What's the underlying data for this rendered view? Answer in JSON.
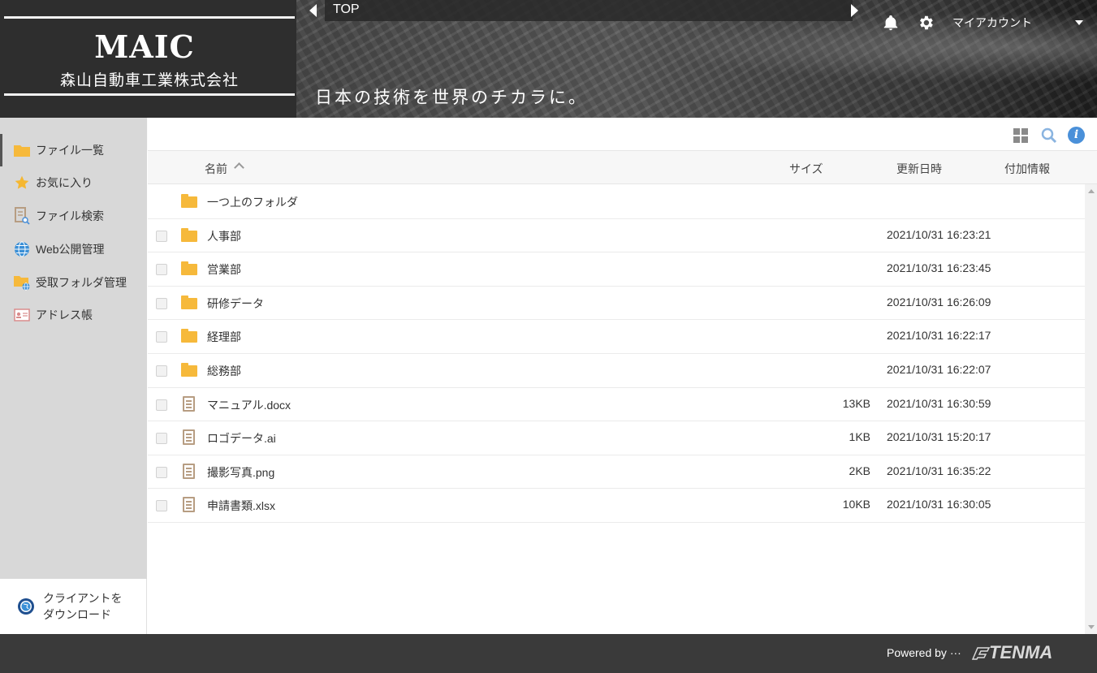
{
  "header": {
    "logo_title": "MAIC",
    "logo_subtitle": "森山自動車工業株式会社",
    "breadcrumb": "TOP",
    "account_label": "マイアカウント",
    "slogan": "日本の技術を世界のチカラに。",
    "icons": [
      "bell-icon",
      "gear-icon"
    ]
  },
  "sidebar": {
    "items": [
      {
        "label": "ファイル一覧",
        "icon": "folder-icon",
        "active": true
      },
      {
        "label": "お気に入り",
        "icon": "star-icon"
      },
      {
        "label": "ファイル検索",
        "icon": "file-search-icon"
      },
      {
        "label": "Web公開管理",
        "icon": "globe-icon"
      },
      {
        "label": "受取フォルダ管理",
        "icon": "folder-globe-icon"
      },
      {
        "label": "アドレス帳",
        "icon": "address-card-icon"
      }
    ],
    "client_download": "クライアントを\nダウンロード"
  },
  "table": {
    "headers": {
      "name": "名前",
      "size": "サイズ",
      "date": "更新日時",
      "extra": "付加情報"
    },
    "parent_folder": "一つ上のフォルダ",
    "rows": [
      {
        "type": "folder",
        "name": "人事部",
        "size": "",
        "date": "2021/10/31 16:23:21"
      },
      {
        "type": "folder",
        "name": "営業部",
        "size": "",
        "date": "2021/10/31 16:23:45"
      },
      {
        "type": "folder",
        "name": "研修データ",
        "size": "",
        "date": "2021/10/31 16:26:09"
      },
      {
        "type": "folder",
        "name": "経理部",
        "size": "",
        "date": "2021/10/31 16:22:17"
      },
      {
        "type": "folder",
        "name": "総務部",
        "size": "",
        "date": "2021/10/31 16:22:07"
      },
      {
        "type": "file",
        "name": "マニュアル.docx",
        "size": "13KB",
        "date": "2021/10/31 16:30:59"
      },
      {
        "type": "file",
        "name": "ロゴデータ.ai",
        "size": "1KB",
        "date": "2021/10/31 15:20:17"
      },
      {
        "type": "file",
        "name": "撮影写真.png",
        "size": "2KB",
        "date": "2021/10/31 16:35:22"
      },
      {
        "type": "file",
        "name": "申請書類.xlsx",
        "size": "10KB",
        "date": "2021/10/31 16:30:05"
      }
    ]
  },
  "footer": {
    "powered_by": "Powered by ···",
    "brand": "TENMA"
  },
  "colors": {
    "header_bg": "#3c3c3c",
    "sidebar_bg": "#d8d8d8",
    "folder": "#f6b93b",
    "info_accent": "#4a90d9",
    "footer_bg": "#3a3a3a"
  }
}
